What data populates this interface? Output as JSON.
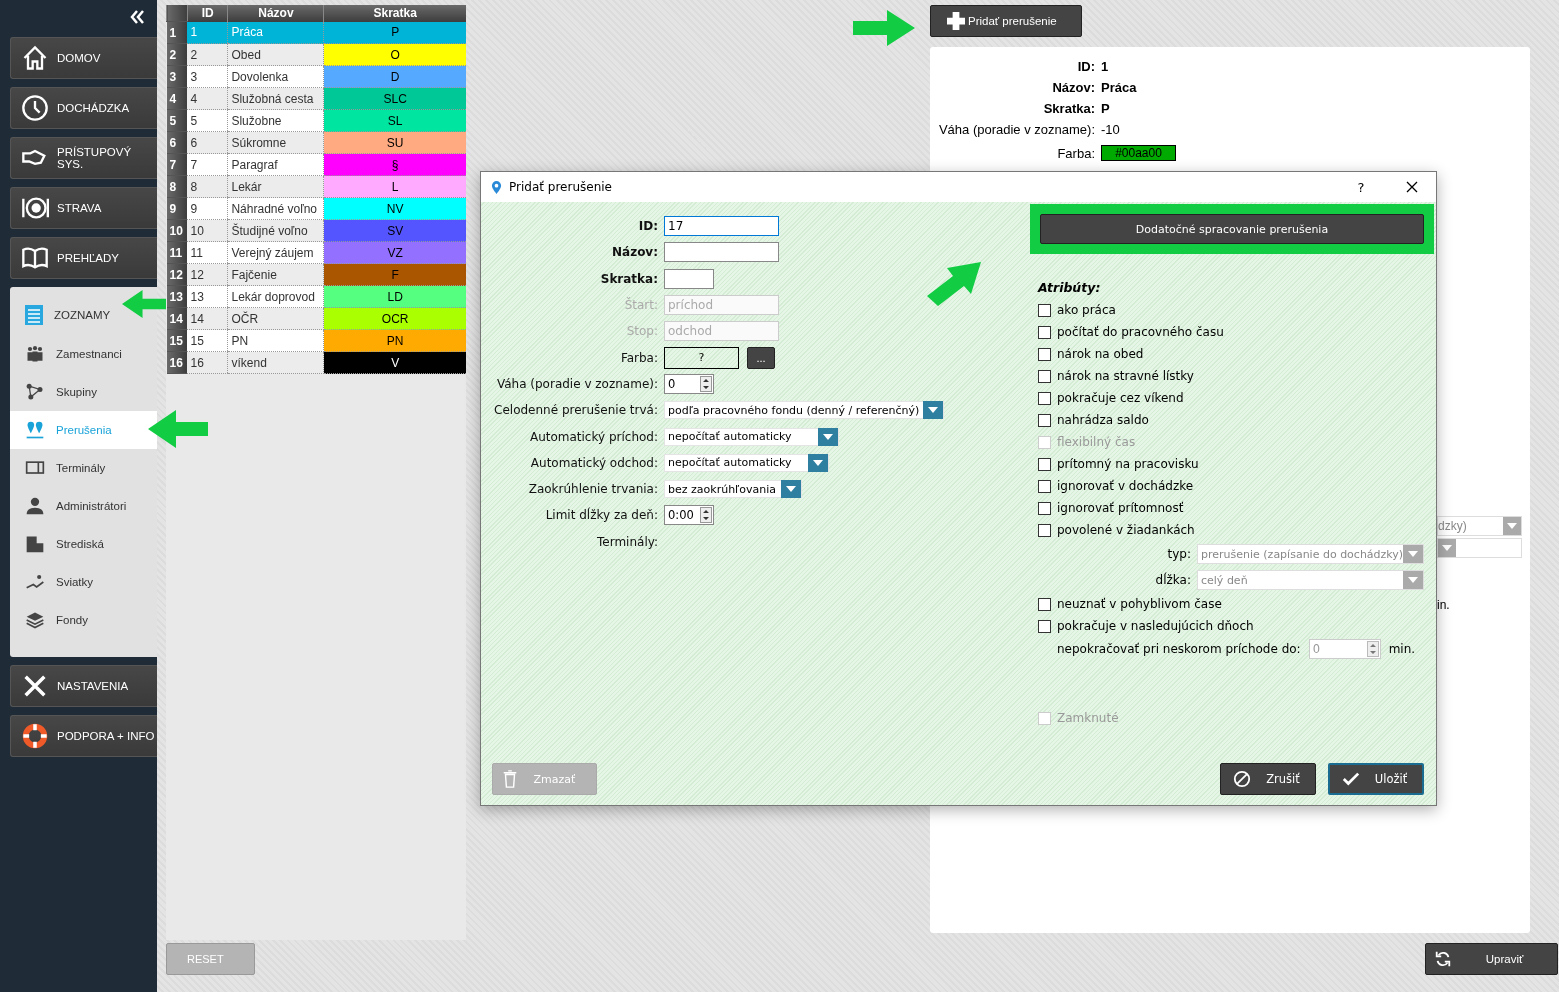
{
  "sidebar": {
    "items": [
      {
        "label": "DOMOV",
        "expanded": false
      },
      {
        "label": "DOCHÁDZKA",
        "expanded": false
      },
      {
        "label": "PRÍSTUPOVÝ SYS.",
        "expanded": false
      },
      {
        "label": "STRAVA",
        "expanded": false
      },
      {
        "label": "PREHĽADY",
        "expanded": false
      },
      {
        "label": "ZOZNAMY",
        "expanded": true,
        "children": [
          {
            "label": "Zamestnanci",
            "selected": false
          },
          {
            "label": "Skupiny",
            "selected": false
          },
          {
            "label": "Prerušenia",
            "selected": true
          },
          {
            "label": "Terminály",
            "selected": false
          },
          {
            "label": "Administrátori",
            "selected": false
          },
          {
            "label": "Strediská",
            "selected": false
          },
          {
            "label": "Sviatky",
            "selected": false
          },
          {
            "label": "Fondy",
            "selected": false
          }
        ]
      },
      {
        "label": "NASTAVENIA",
        "expanded": false
      },
      {
        "label": "PODPORA + INFO",
        "expanded": false
      }
    ]
  },
  "table": {
    "columns": [
      "ID",
      "Názov",
      "Skratka"
    ],
    "rows": [
      {
        "number": "1",
        "id": "1",
        "name": "Práca",
        "abbr": "P",
        "color": "#00b4d8",
        "selected": true
      },
      {
        "number": "2",
        "id": "2",
        "name": "Obed",
        "abbr": "O",
        "color": "#ffff00",
        "selected": false
      },
      {
        "number": "3",
        "id": "3",
        "name": "Dovolenka",
        "abbr": "D",
        "color": "#55aaff",
        "selected": false
      },
      {
        "number": "4",
        "id": "4",
        "name": "Služobná cesta",
        "abbr": "SLC",
        "color": "#00c896",
        "selected": false
      },
      {
        "number": "5",
        "id": "5",
        "name": "Služobne",
        "abbr": "SL",
        "color": "#00e5a0",
        "selected": false
      },
      {
        "number": "6",
        "id": "6",
        "name": "Súkromne",
        "abbr": "SU",
        "color": "#ffaa80",
        "selected": false
      },
      {
        "number": "7",
        "id": "7",
        "name": "Paragraf",
        "abbr": "§",
        "color": "#ff00ff",
        "selected": false
      },
      {
        "number": "8",
        "id": "8",
        "name": "Lekár",
        "abbr": "L",
        "color": "#ffaaff",
        "selected": false
      },
      {
        "number": "9",
        "id": "9",
        "name": "Náhradné voľno",
        "abbr": "NV",
        "color": "#00ffff",
        "selected": false
      },
      {
        "number": "10",
        "id": "10",
        "name": "Študijné voľno",
        "abbr": "SV",
        "color": "#5555ff",
        "selected": false
      },
      {
        "number": "11",
        "id": "11",
        "name": "Verejný záujem",
        "abbr": "VZ",
        "color": "#9370ff",
        "selected": false
      },
      {
        "number": "12",
        "id": "12",
        "name": "Fajčenie",
        "abbr": "F",
        "color": "#aa5500",
        "selected": false
      },
      {
        "number": "13",
        "id": "13",
        "name": "Lekár doprovod",
        "abbr": "LD",
        "color": "#55ff80",
        "selected": false
      },
      {
        "number": "14",
        "id": "14",
        "name": "OČR",
        "abbr": "OCR",
        "color": "#aaff00",
        "selected": false
      },
      {
        "number": "15",
        "id": "15",
        "name": "PN",
        "abbr": "PN",
        "color": "#ffaa00",
        "selected": false
      },
      {
        "number": "16",
        "id": "16",
        "name": "víkend",
        "abbr": "V",
        "color": "#000000",
        "selected": false
      }
    ]
  },
  "reset_button": {
    "label": "RESET",
    "disabled": true
  },
  "add_button": "Pridať prerušenie",
  "detail": {
    "fields": [
      {
        "label": "ID:",
        "value": "1",
        "bold": true
      },
      {
        "label": "Názov:",
        "value": "Práca",
        "bold": true
      },
      {
        "label": "Skratka:",
        "value": "P",
        "bold": true
      },
      {
        "label": "Váha (poradie v zozname):",
        "value": "-10",
        "bold": false
      }
    ],
    "color_field": {
      "label": "Farba:",
      "value": "#00aa00",
      "color": "#00aa00"
    },
    "covered_dropdowns": [
      {
        "value": "dzky)",
        "disabled": true
      },
      {
        "disabled": true
      }
    ],
    "covered_text": "in."
  },
  "edit_button": "Upraviť",
  "dialog": {
    "title": "Pridať prerušenie",
    "help": "?",
    "form": [
      {
        "kind": "text",
        "label": "ID:",
        "bold": true,
        "value": "17",
        "focused": true,
        "disabled": false
      },
      {
        "kind": "text",
        "label": "Názov:",
        "bold": true,
        "focused": false,
        "disabled": false
      },
      {
        "kind": "text",
        "label": "Skratka:",
        "bold": true,
        "focused": false,
        "disabled": false
      },
      {
        "kind": "text",
        "label": "Štart:",
        "bold": false,
        "placeholder": "príchod",
        "focused": false,
        "disabled": true
      },
      {
        "kind": "text",
        "label": "Stop:",
        "bold": false,
        "placeholder": "odchod",
        "focused": false,
        "disabled": true
      },
      {
        "kind": "color",
        "label": "Farba:",
        "bold": false,
        "value": "?",
        "button": "..."
      },
      {
        "kind": "spin",
        "label": "Váha (poradie v zozname):",
        "bold": false,
        "value": "0"
      },
      {
        "kind": "select",
        "label": "Celodenné prerušenie trvá:",
        "bold": false,
        "value": "podľa pracovného fondu (denný / referenčný)"
      },
      {
        "kind": "select",
        "label": "Automatický príchod:",
        "bold": false,
        "value": "nepočítať automaticky"
      },
      {
        "kind": "select",
        "label": "Automatický odchod:",
        "bold": false,
        "value": "nepočítať automaticky"
      },
      {
        "kind": "select",
        "label": "Zaokrúhlenie trvania:",
        "bold": false,
        "value": "bez zaokrúhľovania"
      },
      {
        "kind": "spin",
        "label": "Limit dĺžky za deň:",
        "bold": false,
        "value": "0:00"
      },
      {
        "kind": "label",
        "label": "Terminály:",
        "bold": false
      }
    ],
    "extra_button": "Dodatočné spracovanie prerušenia",
    "attributes_title": "Atribúty:",
    "attributes": [
      {
        "kind": "checkbox",
        "label": "ako práca",
        "checked": false,
        "disabled": false
      },
      {
        "kind": "checkbox",
        "label": "počítať do pracovného času",
        "checked": false,
        "disabled": false
      },
      {
        "kind": "checkbox",
        "label": "nárok na obed",
        "checked": false,
        "disabled": false
      },
      {
        "kind": "checkbox",
        "label": "nárok na stravné lístky",
        "checked": false,
        "disabled": false
      },
      {
        "kind": "checkbox",
        "label": "pokračuje cez víkend",
        "checked": false,
        "disabled": false
      },
      {
        "kind": "checkbox",
        "label": "nahrádza saldo",
        "checked": false,
        "disabled": false
      },
      {
        "kind": "checkbox",
        "label": "flexibilný čas",
        "checked": false,
        "disabled": true
      },
      {
        "kind": "checkbox",
        "label": "prítomný na pracovisku",
        "checked": false,
        "disabled": false
      },
      {
        "kind": "checkbox",
        "label": "ignorovať v dochádzke",
        "checked": false,
        "disabled": false
      },
      {
        "kind": "checkbox",
        "label": "ignorovať prítomnosť",
        "checked": false,
        "disabled": false
      },
      {
        "kind": "checkbox",
        "label": "povolené v žiadankách",
        "checked": false,
        "disabled": false
      },
      {
        "kind": "select",
        "label": "typ:",
        "value": "prerušenie (zapísanie do dochádzky)",
        "disabled": true
      },
      {
        "kind": "select",
        "label": "dĺžka:",
        "value": "celý deň",
        "disabled": true
      },
      {
        "kind": "checkbox",
        "label": "neuznať v pohyblivom čase",
        "checked": false,
        "disabled": false
      },
      {
        "kind": "checkbox",
        "label": "pokračuje v nasledujúcich dňoch",
        "checked": false,
        "disabled": false
      },
      {
        "kind": "spin",
        "label": "nepokračovať pri neskorom príchode do:",
        "value": "0",
        "unit": "min.",
        "disabled": true
      }
    ],
    "locked": {
      "label": "Zamknuté",
      "checked": false,
      "disabled": true
    },
    "delete_button": {
      "label": "Zmazať",
      "disabled": true
    },
    "cancel_button": "Zrušiť",
    "save_button": "Uložiť"
  }
}
